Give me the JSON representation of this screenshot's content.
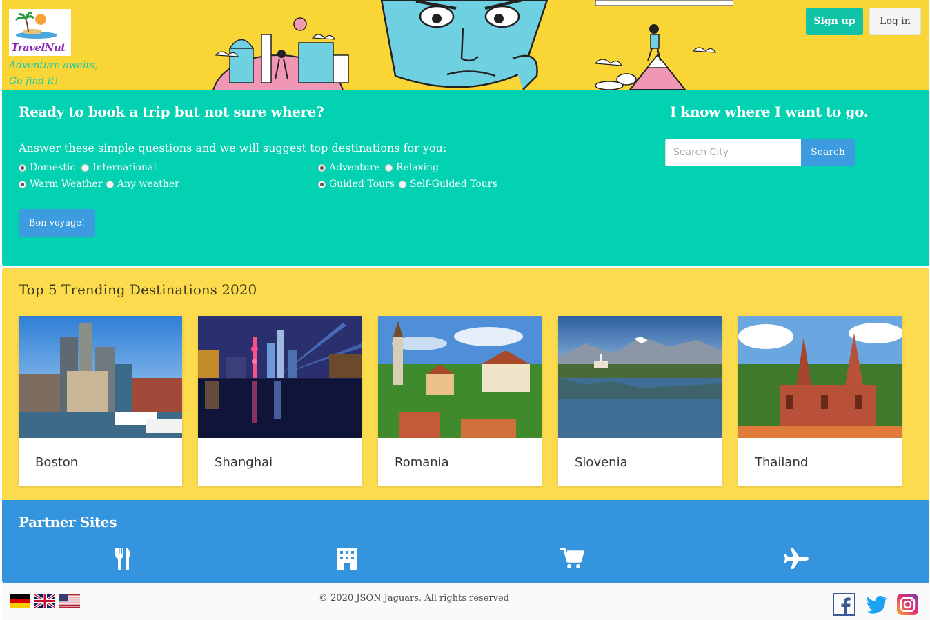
{
  "brand": {
    "logo_text": "TravelNut",
    "tagline_line1": "Adventure awaits,",
    "tagline_line2": "Go find it!"
  },
  "header": {
    "signup_label": "Sign up",
    "login_label": "Log in"
  },
  "quiz": {
    "title": "Ready to book a trip but not sure where?",
    "subtitle": "Answer these simple questions and we will suggest top destinations for you:",
    "options": [
      {
        "label": "Domestic",
        "checked": true
      },
      {
        "label": "International",
        "checked": false
      },
      {
        "label": "Warm Weather",
        "checked": true
      },
      {
        "label": "Any weather",
        "checked": false
      },
      {
        "label": "Adventure",
        "checked": true
      },
      {
        "label": "Relaxing",
        "checked": false
      },
      {
        "label": "Guided Tours",
        "checked": true
      },
      {
        "label": "Self-Guided Tours",
        "checked": false
      }
    ],
    "submit_label": "Bon voyage!"
  },
  "search": {
    "title": "I know where I want to go.",
    "placeholder": "Search City",
    "button_label": "Search"
  },
  "trending": {
    "title": "Top 5 Trending Destinations 2020",
    "destinations": [
      {
        "name": "Boston"
      },
      {
        "name": "Shanghai"
      },
      {
        "name": "Romania"
      },
      {
        "name": "Slovenia"
      },
      {
        "name": "Thailand"
      }
    ]
  },
  "partners": {
    "title": "Partner Sites",
    "icons": [
      "restaurant-icon",
      "hotel-icon",
      "shopping-cart-icon",
      "airplane-icon"
    ]
  },
  "footer": {
    "copyright": "© 2020 JSON Jaguars, All rights reserved",
    "flags": [
      "germany-flag-icon",
      "uk-flag-icon",
      "us-flag-icon"
    ],
    "social": [
      "facebook-icon",
      "twitter-icon",
      "instagram-icon"
    ]
  },
  "colors": {
    "hero_yellow": "#f9d536",
    "teal": "#02d1b2",
    "trending_yellow": "#fddb4f",
    "partner_blue": "#3494de",
    "button_blue": "#3d9be0"
  }
}
